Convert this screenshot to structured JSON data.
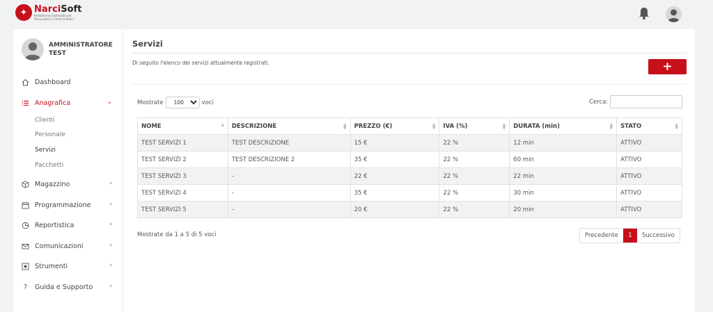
{
  "brand": {
    "name_a": "Narci",
    "name_b": "Soft",
    "tagline": "Piattaforma Gestionale per Parrucchieri e Centri Estetici"
  },
  "header": {
    "bell_icon": "bell-icon",
    "avatar_icon": "user-avatar-icon"
  },
  "sidebar": {
    "user_name": "AMMINISTRATORE TEST",
    "items": [
      {
        "label": "Dashboard",
        "icon": "home-icon"
      },
      {
        "label": "Anagrafica",
        "icon": "list-icon"
      },
      {
        "label": "Magazzino",
        "icon": "box-icon"
      },
      {
        "label": "Programmazione",
        "icon": "calendar-icon"
      },
      {
        "label": "Reportistica",
        "icon": "pie-chart-icon"
      },
      {
        "label": "Comunicazioni",
        "icon": "mail-icon"
      },
      {
        "label": "Strumenti",
        "icon": "tools-icon"
      },
      {
        "label": "Guida e Supporto",
        "icon": "help-icon"
      }
    ],
    "subitems": [
      {
        "label": "Clienti"
      },
      {
        "label": "Personale"
      },
      {
        "label": "Servizi"
      },
      {
        "label": "Pacchetti"
      }
    ]
  },
  "main": {
    "title": "Servizi",
    "description": "Di seguito l'elenco dei servizi attualmente registrati.",
    "add_label": "+",
    "length_prefix": "Mostrate",
    "length_value": "100",
    "length_suffix": "voci",
    "search_label": "Cerca:",
    "search_value": "",
    "columns": [
      "NOME",
      "DESCRIZIONE",
      "PREZZO (€)",
      "IVA (%)",
      "DURATA (min)",
      "STATO"
    ],
    "rows": [
      [
        "TEST SERVIZI 1",
        "TEST DESCRIZIONE",
        "15 €",
        "22 %",
        "12 min",
        "ATTIVO"
      ],
      [
        "TEST SERVIZI 2",
        "TEST DESCRIZIONE 2",
        "35 €",
        "22 %",
        "60 min",
        "ATTIVO"
      ],
      [
        "TEST SERVIZI 3",
        "-",
        "22 €",
        "22 %",
        "22 min",
        "ATTIVO"
      ],
      [
        "TEST SERVIZI 4",
        "-",
        "35 €",
        "22 %",
        "30 min",
        "ATTIVO"
      ],
      [
        "TEST SERVIZI 5",
        "-",
        "20 €",
        "22 %",
        "20 min",
        "ATTIVO"
      ]
    ],
    "info": "Mostrate da 1 a 5 di 5 voci",
    "pager": {
      "prev": "Precedente",
      "current": "1",
      "next": "Successivo"
    }
  },
  "colors": {
    "accent": "#c8101a",
    "background": "#f1f2f4"
  }
}
